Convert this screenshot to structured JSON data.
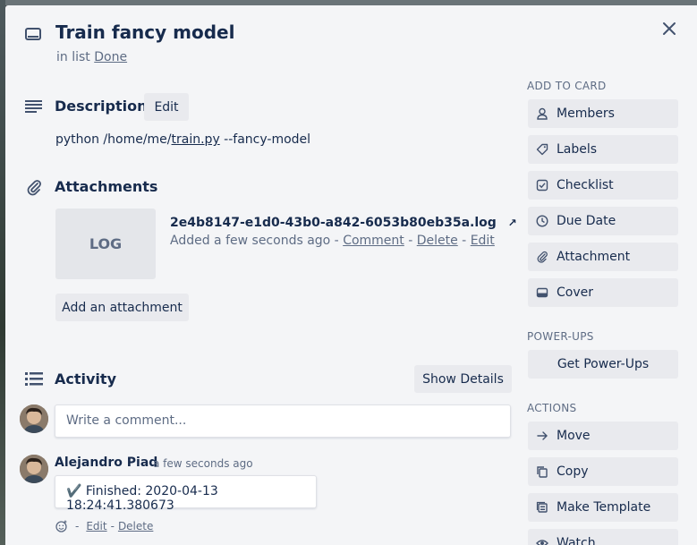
{
  "card": {
    "title": "Train fancy model",
    "in_list_prefix": "in list",
    "list_name": "Done"
  },
  "description": {
    "heading": "Description",
    "edit_label": "Edit",
    "text_prefix": "python /home/me/",
    "text_link": "train.py",
    "text_suffix": " --fancy-model"
  },
  "attachments": {
    "heading": "Attachments",
    "thumb_label": "LOG",
    "file_name": "2e4b8147-e1d0-43b0-a842-6053b80eb35a.log",
    "open_glyph": "↗",
    "meta_prefix": "Added a few seconds ago - ",
    "comment_link": "Comment",
    "sep1": " - ",
    "delete_link": "Delete",
    "sep2": " - ",
    "edit_link": "Edit",
    "add_button": "Add an attachment"
  },
  "activity": {
    "heading": "Activity",
    "show_details": "Show Details",
    "comment_placeholder": "Write a comment...",
    "entry": {
      "author": "Alejandro Piad",
      "time": "a few seconds ago",
      "text": "✔️ Finished: 2020-04-13 18:24:41.380673",
      "sep": "-",
      "edit": "Edit",
      "sep2": "-",
      "delete": "Delete"
    }
  },
  "sidebar": {
    "add_to_card": "ADD TO CARD",
    "add_items": [
      {
        "label": "Members",
        "icon": "person-icon"
      },
      {
        "label": "Labels",
        "icon": "tag-icon"
      },
      {
        "label": "Checklist",
        "icon": "checklist-icon"
      },
      {
        "label": "Due Date",
        "icon": "clock-icon"
      },
      {
        "label": "Attachment",
        "icon": "paperclip-icon"
      },
      {
        "label": "Cover",
        "icon": "cover-icon"
      }
    ],
    "power_ups": "POWER-UPS",
    "get_power_ups": "Get Power-Ups",
    "actions": "ACTIONS",
    "action_items": [
      {
        "label": "Move",
        "icon": "arrow-right-icon"
      },
      {
        "label": "Copy",
        "icon": "copy-icon"
      },
      {
        "label": "Make Template",
        "icon": "template-icon"
      },
      {
        "label": "Watch",
        "icon": "eye-icon"
      }
    ]
  },
  "colors": {
    "panel": "#f4f5f7",
    "button": "#e9eaee",
    "text": "#172b4d",
    "muted": "#5e6c84"
  }
}
